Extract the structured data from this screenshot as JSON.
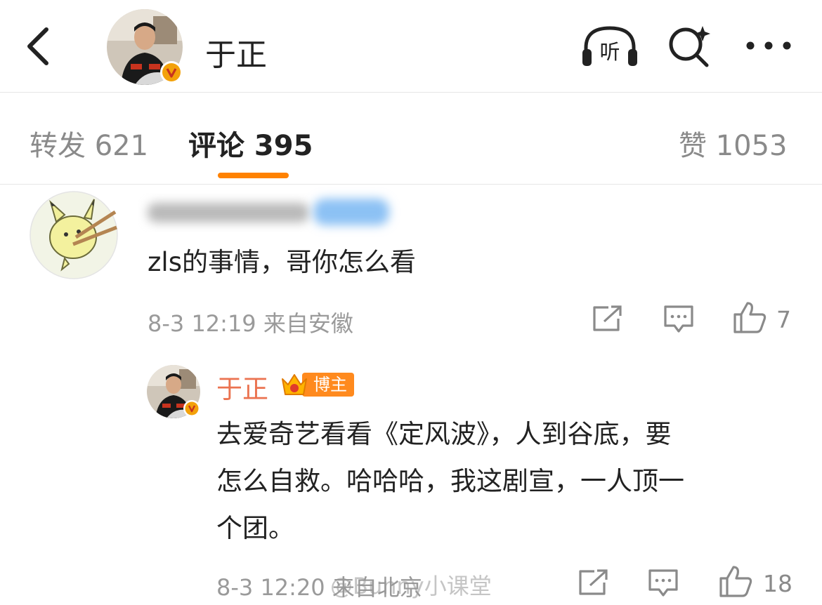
{
  "header": {
    "title": "于正",
    "listen_label": "听",
    "icons": [
      "back-chevron-icon",
      "listen-headphones-icon",
      "search-icon",
      "more-icon"
    ]
  },
  "tabs": {
    "repost_label": "转发 621",
    "comments_label": "评论 395",
    "likes_label": "赞 1053",
    "active": "comments",
    "accent_color": "#ff8200"
  },
  "comment": {
    "text": "zls的事情，哥你怎么看",
    "meta": "8-3 12:19 来自安徽",
    "like_count": "7"
  },
  "reply": {
    "author": "于正",
    "badge": "博主",
    "text_lines": [
      "去爱奇艺看看《定风波》，人到谷底，要",
      "怎么自救。哈哈哈，我这剧宣，一人顶一",
      "个团。"
    ],
    "meta": "8-3 12:20 来自北京",
    "like_count": "18",
    "name_color": "#eb7350"
  },
  "watermark": "@Bunny小课堂"
}
